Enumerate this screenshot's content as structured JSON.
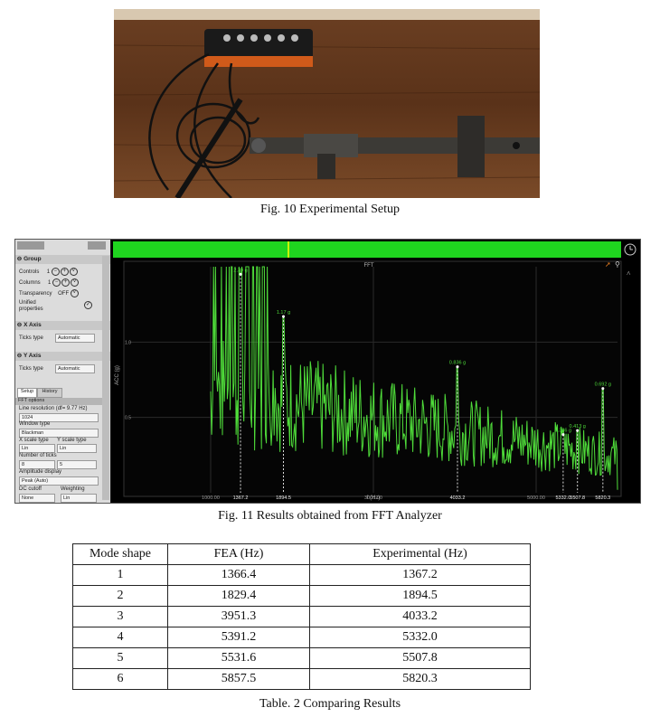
{
  "figures": {
    "fig10_caption": "Fig. 10 Experimental Setup",
    "fig11_caption": "Fig. 11 Results obtained from FFT Analyzer",
    "table2_caption": "Table. 2 Comparing Results"
  },
  "fft_panel": {
    "group_header": "Group",
    "controls_label": "Controls",
    "controls_value": "1",
    "columns_label": "Columns",
    "columns_value": "1",
    "transparency_label": "Transparency",
    "transparency_value": "OFF",
    "unified_label": "Unified properties",
    "xaxis_header": "X Axis",
    "xaxis_ticks_label": "Ticks type",
    "xaxis_ticks_value": "Automatic",
    "yaxis_header": "Y Axis",
    "yaxis_ticks_label": "Ticks type",
    "yaxis_ticks_value": "Automatic",
    "tab_setup": "Setup",
    "tab_history": "History",
    "fft_options_header": "FFT options",
    "line_res_label": "Line resolution (df= 9.77 Hz)",
    "line_res_value": "1024",
    "window_type_label": "Window type",
    "window_type_value": "Blackman",
    "xscale_label": "X scale type",
    "xscale_value": "Lin",
    "yscale_label": "Y scale type",
    "yscale_value": "Lin",
    "num_ticks_label": "Number of ticks",
    "num_ticks_x": "8",
    "num_ticks_y": "5",
    "amp_display_label": "Amplitude display",
    "amp_display_value": "Peak (Auto)",
    "dc_cutoff_label": "DC cutoff",
    "dc_cutoff_value": "None",
    "weighting_label": "Weighting",
    "weighting_value": "Lin"
  },
  "chart_data": {
    "type": "line",
    "title": "FFT",
    "xlabel": "f (Hz)",
    "ylabel": "ACC (g)",
    "xlim": [
      0,
      6000
    ],
    "ylim": [
      0,
      1.5
    ],
    "x_ticks": [
      "1000.00",
      "3000.00",
      "5000.00"
    ],
    "y_ticks": [
      "1.0",
      "0.5"
    ],
    "line_color": "#4fdc3a",
    "peaks": [
      {
        "x": 1367.2,
        "y": 1.45,
        "amp_label": "2.39 g",
        "x_label": "1367.2"
      },
      {
        "x": 1894.5,
        "y": 1.17,
        "amp_label": "1.17 g",
        "x_label": "1894.5"
      },
      {
        "x": 4033.2,
        "y": 0.836,
        "amp_label": "0.836 g",
        "x_label": "4033.2"
      },
      {
        "x": 5332.0,
        "y": 0.386,
        "amp_label": "0.386 g",
        "x_label": "5332.0"
      },
      {
        "x": 5507.8,
        "y": 0.413,
        "amp_label": "0.413 g",
        "x_label": "5507.8"
      },
      {
        "x": 5820.3,
        "y": 0.692,
        "amp_label": "0.692 g",
        "x_label": "5820.3"
      }
    ]
  },
  "table": {
    "headers": [
      "Mode shape",
      "FEA (Hz)",
      "Experimental (Hz)"
    ],
    "rows": [
      [
        "1",
        "1366.4",
        "1367.2"
      ],
      [
        "2",
        "1829.4",
        "1894.5"
      ],
      [
        "3",
        "3951.3",
        "4033.2"
      ],
      [
        "4",
        "5391.2",
        "5332.0"
      ],
      [
        "5",
        "5531.6",
        "5507.8"
      ],
      [
        "6",
        "5857.5",
        "5820.3"
      ]
    ]
  }
}
